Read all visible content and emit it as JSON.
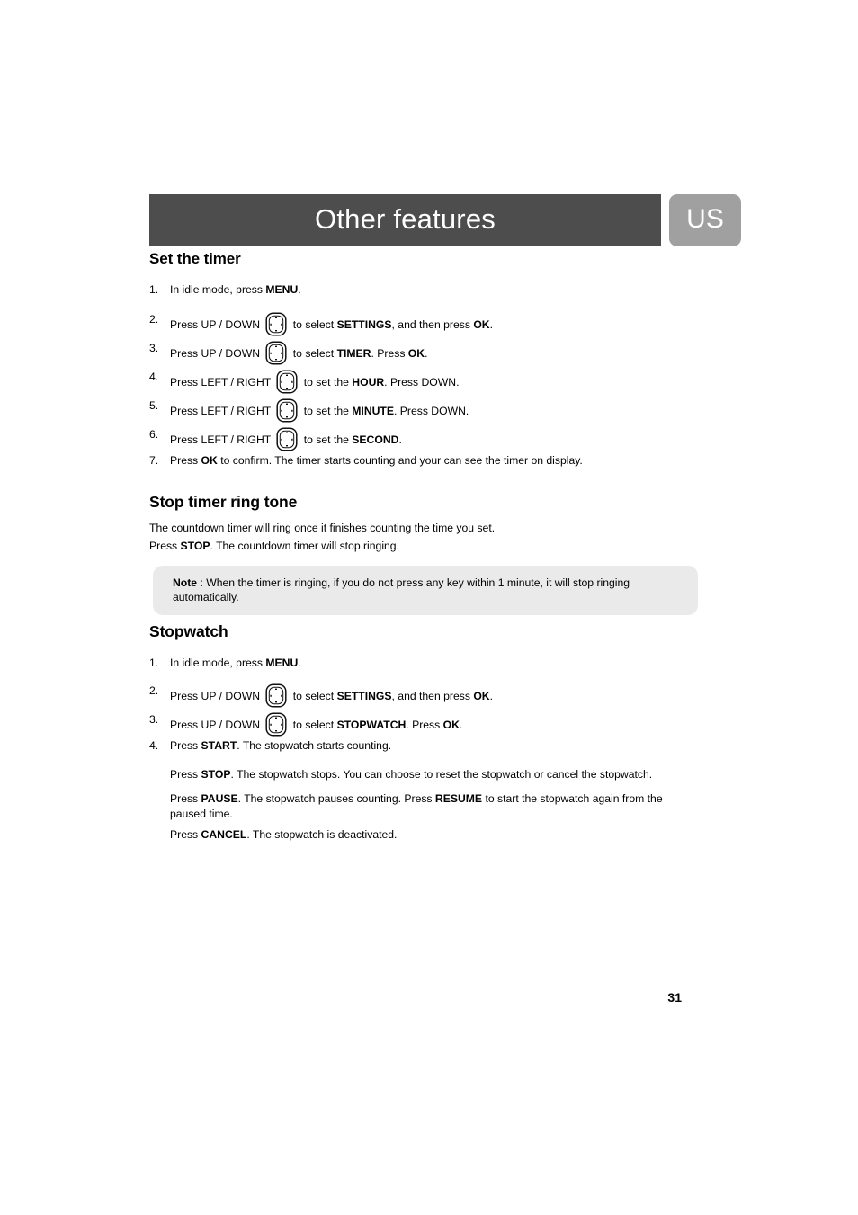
{
  "header": {
    "title": "Other features",
    "language_badge": "US",
    "bar_color": "#4d4d4d",
    "badge_color": "#a0a0a0"
  },
  "sections": {
    "set_timer": {
      "heading": "Set the timer",
      "steps": [
        {
          "num": "1.",
          "pre": "In idle mode, press ",
          "bold1": "MENU",
          "mid": "",
          "bold2": "",
          "post": ".",
          "icon": ""
        },
        {
          "num": "2.",
          "pre": "Press  UP / DOWN ",
          "bold1": "",
          "mid": " to select ",
          "bold2": "SETTINGS",
          "post": ", and then press ",
          "icon": "navigation-key-icon",
          "bold3": "OK",
          "tail": "."
        },
        {
          "num": "3.",
          "pre": "Press  UP / DOWN ",
          "bold1": "",
          "mid": " to select ",
          "bold2": "TIMER",
          "post": ". Press ",
          "icon": "navigation-key-icon",
          "bold3": "OK",
          "tail": "."
        },
        {
          "num": "4.",
          "pre": "Press LEFT / RIGHT ",
          "bold1": "",
          "mid": " to set the ",
          "bold2": "HOUR",
          "post": ". Press DOWN.",
          "icon": "navigation-key-icon",
          "bold3": "",
          "tail": ""
        },
        {
          "num": "5.",
          "pre": "Press LEFT / RIGHT ",
          "bold1": "",
          "mid": " to set the ",
          "bold2": "MINUTE",
          "post": ". Press DOWN.",
          "icon": "navigation-key-icon",
          "bold3": "",
          "tail": ""
        },
        {
          "num": "6.",
          "pre": "Press LEFT / RIGHT ",
          "bold1": "",
          "mid": " to set the ",
          "bold2": "SECOND",
          "post": ".",
          "icon": "navigation-key-icon",
          "bold3": "",
          "tail": ""
        },
        {
          "num": "7.",
          "pre": "Press ",
          "bold1": "OK",
          "mid": " to confirm. The timer starts counting and your can see the timer on display.",
          "bold2": "",
          "post": "",
          "icon": ""
        }
      ]
    },
    "stop_timer_ring_tone": {
      "heading": "Stop timer ring tone",
      "paragraph_1": "The countdown timer will ring once it finishes counting the time you set.",
      "paragraph_2_pre": "Press ",
      "paragraph_2_bold": "STOP",
      "paragraph_2_post": ". The countdown timer will stop ringing.",
      "note": {
        "label": "Note",
        "text": " : When the timer is ringing, if you do not press any key within 1 minute, it will stop ringing automatically."
      }
    },
    "stopwatch": {
      "heading": "Stopwatch",
      "steps": [
        {
          "num": "1.",
          "pre": "In idle mode, press ",
          "bold1": "MENU",
          "mid": "",
          "bold2": "",
          "post": ".",
          "icon": ""
        },
        {
          "num": "2.",
          "pre": "Press  UP / DOWN ",
          "bold1": "",
          "mid": " to select ",
          "bold2": "SETTINGS",
          "post": ", and then press ",
          "icon": "navigation-key-icon",
          "bold3": "OK",
          "tail": "."
        },
        {
          "num": "3.",
          "pre": "Press  UP / DOWN ",
          "bold1": "",
          "mid": " to select ",
          "bold2": "STOPWATCH",
          "post": ". Press ",
          "icon": "navigation-key-icon",
          "bold3": "OK",
          "tail": "."
        },
        {
          "num": "4.",
          "pre": "Press ",
          "bold1": "START",
          "mid": ". The stopwatch starts counting.",
          "bold2": "",
          "post": "",
          "icon": ""
        }
      ],
      "paragraphs": [
        {
          "pre": "Press ",
          "bold1": "STOP",
          "mid": ". The stopwatch stops. You can choose to reset the stopwatch or cancel the stopwatch.",
          "bold2": "",
          "post": ""
        },
        {
          "pre": "Press ",
          "bold1": "PAUSE",
          "mid": ". The stopwatch pauses counting. Press ",
          "bold2": "RESUME",
          "post": " to start the stopwatch again from the paused time."
        },
        {
          "pre": "Press ",
          "bold1": "CANCEL",
          "mid": ". The stopwatch is deactivated.",
          "bold2": "",
          "post": ""
        }
      ]
    }
  },
  "footer": {
    "page_number": "31"
  }
}
